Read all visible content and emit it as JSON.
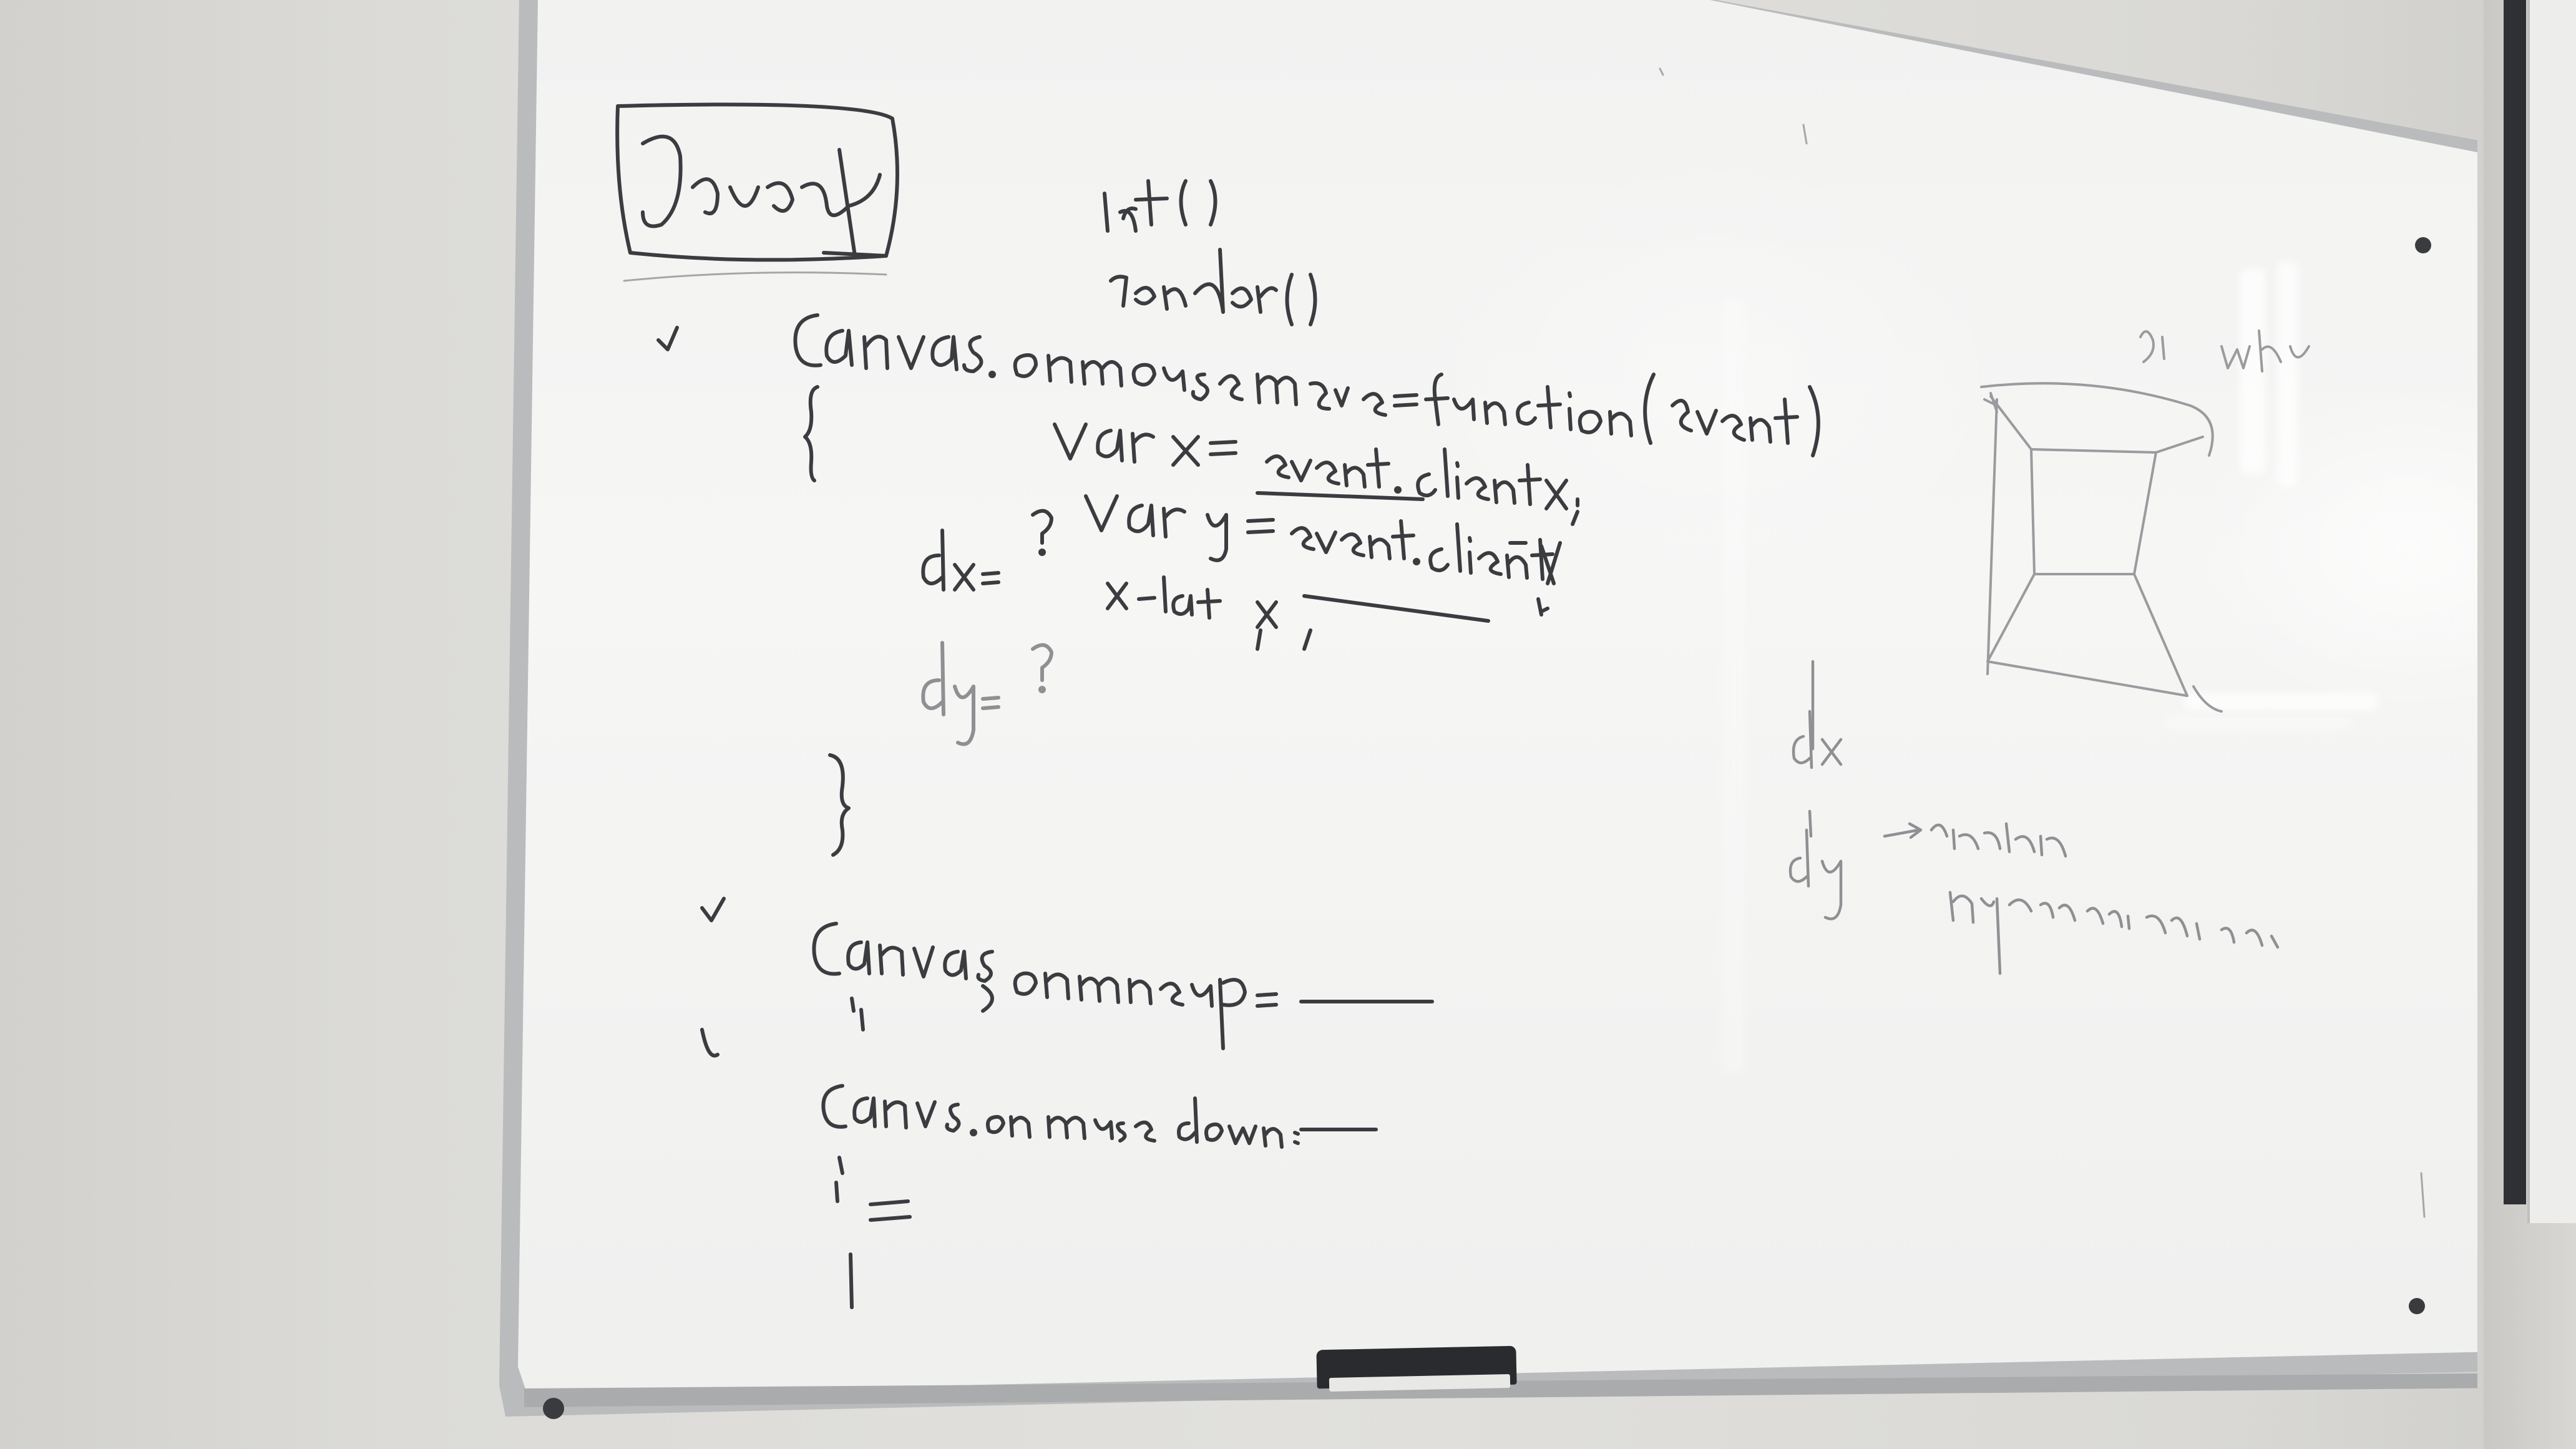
{
  "scene": {
    "subject": "",
    "ink_color": "#3b3c40",
    "faint_ink_color": "#8f9093",
    "board_color": "#f4f4f3",
    "frame_color": "#b9bbbd",
    "wall_color": "#dcdbd7"
  },
  "handwriting_icons": [
    "javascript-handwriting-icon",
    "init-handwriting-icon",
    "render-handwriting-icon",
    "onmousemove-handwriting-icon",
    "var-x-handwriting-icon",
    "var-y-handwriting-icon",
    "dx-handwriting-icon",
    "dy-handwriting-icon",
    "onmouseup-handwriting-icon",
    "onmousedown-handwriting-icon",
    "cube-sketch-icon",
    "side-notes-handwriting-icon"
  ]
}
